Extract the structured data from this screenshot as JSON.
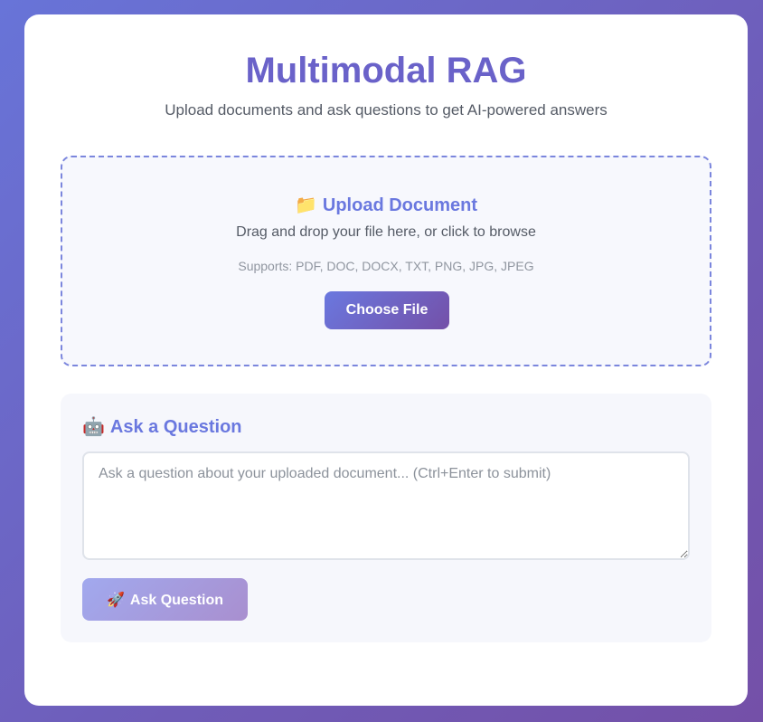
{
  "header": {
    "title": "Multimodal RAG",
    "subtitle": "Upload documents and ask questions to get AI-powered answers"
  },
  "upload": {
    "icon": "folder-icon",
    "icon_glyph": "📁",
    "heading": "Upload Document",
    "description": "Drag and drop your file here, or click to browse",
    "supports": "Supports: PDF, DOC, DOCX, TXT, PNG, JPG, JPEG",
    "button_label": "Choose File"
  },
  "ask": {
    "icon": "robot-icon",
    "icon_glyph": "🤖",
    "heading": "Ask a Question",
    "input_value": "",
    "input_placeholder": "Ask a question about your uploaded document... (Ctrl+Enter to submit)",
    "button_icon": "rocket-icon",
    "button_icon_glyph": "🚀",
    "button_label": "Ask Question",
    "button_enabled": false
  },
  "colors": {
    "accent": "#6a78df",
    "title": "#6a62c9",
    "gradient_start": "#6a78df",
    "gradient_end": "#7450a8"
  }
}
